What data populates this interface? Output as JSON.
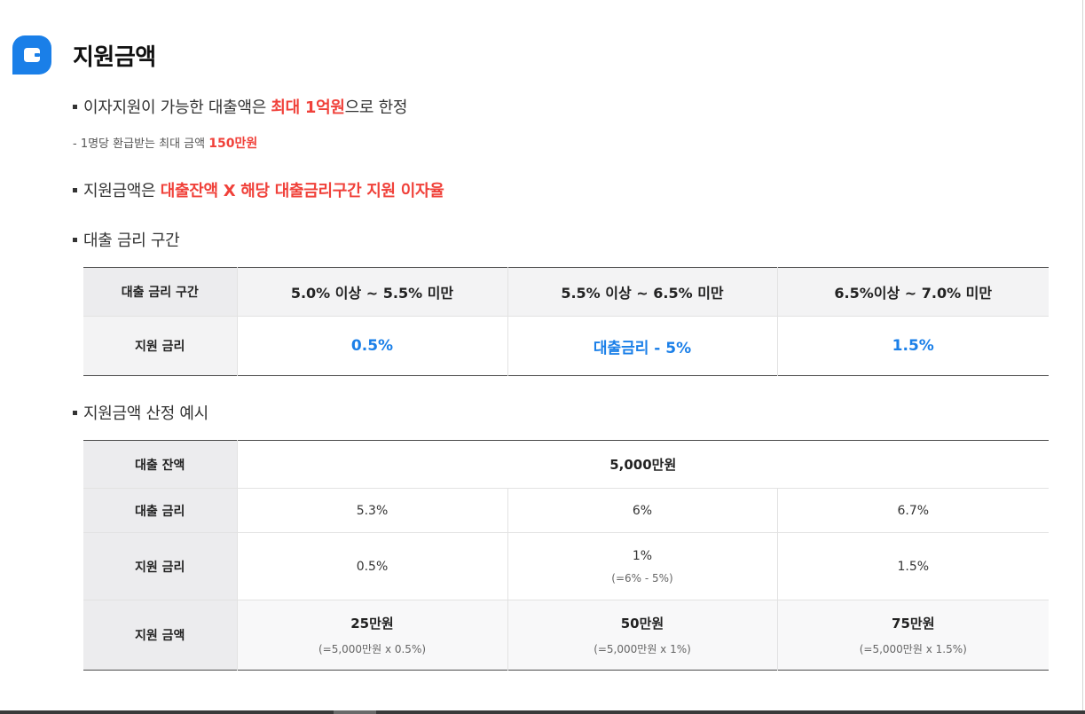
{
  "section": {
    "title": "지원금액",
    "icon": "wallet-icon",
    "accent": "#1a7fe8",
    "highlight": "#f0413a"
  },
  "bullet1": {
    "pre": "이자지원이 가능한 대출액은 ",
    "highlight": "최대 1억원",
    "post": "으로 한정"
  },
  "sub1": {
    "pre": "- 1명당 환급받는 최대 금액 ",
    "highlight": "150만원"
  },
  "bullet2": {
    "pre": "지원금액은 ",
    "highlight": "대출잔액 X 해당 대출금리구간 지원 이자율"
  },
  "bullet3": {
    "text": "대출 금리 구간"
  },
  "rate_table": {
    "header_label": "대출 금리 구간",
    "ranges": [
      "5.0% 이상 ~ 5.5% 미만",
      "5.5% 이상 ~ 6.5% 미만",
      "6.5%이상 ~ 7.0% 미만"
    ],
    "row_label": "지원 금리",
    "support": [
      "0.5%",
      "대출금리 - 5%",
      "1.5%"
    ]
  },
  "bullet4": {
    "text": "지원금액 산정 예시"
  },
  "example_table": {
    "balance_label": "대출 잔액",
    "balance_value": "5,000만원",
    "loan_rate_label": "대출 금리",
    "loan_rates": [
      "5.3%",
      "6%",
      "6.7%"
    ],
    "support_rate_label": "지원 금리",
    "support_rates": [
      {
        "value": "0.5%",
        "note": ""
      },
      {
        "value": "1%",
        "note": "(=6% - 5%)"
      },
      {
        "value": "1.5%",
        "note": ""
      }
    ],
    "amount_label": "지원 금액",
    "amounts": [
      {
        "value": "25만원",
        "note": "(=5,000만원 x 0.5%)"
      },
      {
        "value": "50만원",
        "note": "(=5,000만원 x 1%)"
      },
      {
        "value": "75만원",
        "note": "(=5,000만원 x 1.5%)"
      }
    ]
  }
}
